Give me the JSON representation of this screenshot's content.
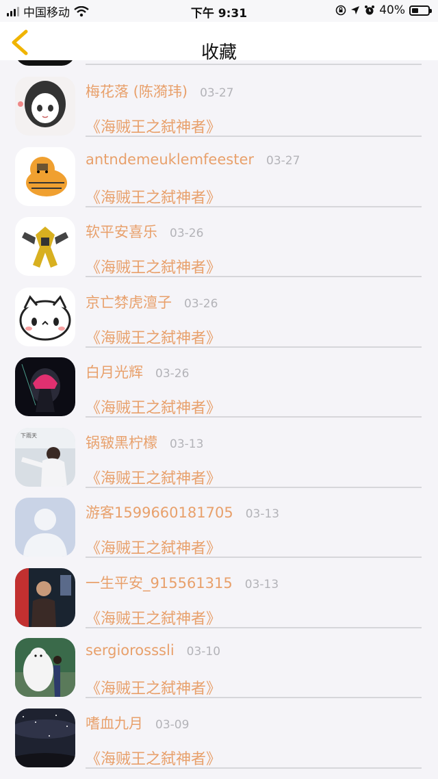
{
  "status_bar": {
    "carrier": "中国移动",
    "time": "下午 9:31",
    "battery_text": "40%",
    "battery_level": 0.4
  },
  "nav": {
    "title": "收藏",
    "back_icon": "chevron-left-icon"
  },
  "items": [
    {
      "name": "梅花落 (陈漪玮)",
      "date": "03-27",
      "book": "《海贼王之弑神者》",
      "avatar": "anime-girl"
    },
    {
      "name": "antndemeuklemfeester",
      "date": "03-27",
      "book": "《海贼王之弑神者》",
      "avatar": "tiger"
    },
    {
      "name": "软平安喜乐",
      "date": "03-26",
      "book": "《海贼王之弑神者》",
      "avatar": "robot"
    },
    {
      "name": "京亡棼虎澶子",
      "date": "03-26",
      "book": "《海贼王之弑神者》",
      "avatar": "cute-cat"
    },
    {
      "name": "白月光辉",
      "date": "03-26",
      "book": "《海贼王之弑神者》",
      "avatar": "dark-figure"
    },
    {
      "name": "锅皲黑柠檬",
      "date": "03-13",
      "book": "《海贼王之弑神者》",
      "avatar": "girl-white"
    },
    {
      "name": "游客1599660181705",
      "date": "03-13",
      "book": "《海贼王之弑神者》",
      "avatar": "default-user"
    },
    {
      "name": "一生平安_915561315",
      "date": "03-13",
      "book": "《海贼王之弑神者》",
      "avatar": "man-photo"
    },
    {
      "name": "sergiorosssli",
      "date": "03-10",
      "book": "《海贼王之弑神者》",
      "avatar": "baymax"
    },
    {
      "name": "嗜血九月",
      "date": "03-09",
      "book": "《海贼王之弑神者》",
      "avatar": "night-sky"
    }
  ]
}
